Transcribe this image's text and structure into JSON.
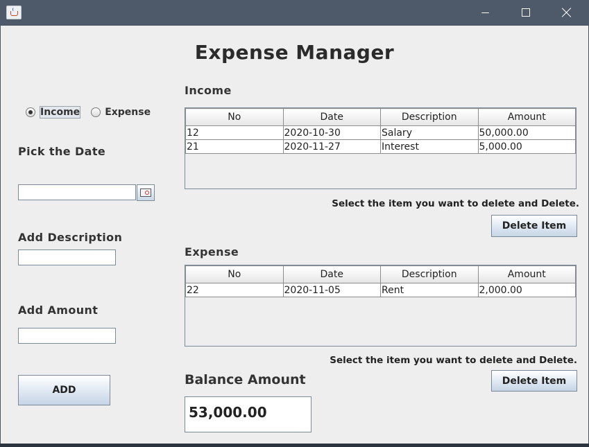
{
  "window": {
    "title": ""
  },
  "app_title": "Expense Manager",
  "entry": {
    "type_options": [
      {
        "label": "Income",
        "checked": true
      },
      {
        "label": "Expense",
        "checked": false
      }
    ],
    "date_label": "Pick the Date",
    "date_value": "",
    "description_label": "Add Description",
    "description_value": "",
    "amount_label": "Add Amount",
    "amount_value": "",
    "add_button": "ADD"
  },
  "income": {
    "title": "Income",
    "columns": [
      "No",
      "Date",
      "Description",
      "Amount"
    ],
    "rows": [
      [
        "12",
        "2020-10-30",
        "Salary",
        "50,000.00"
      ],
      [
        "21",
        "2020-11-27",
        "Interest",
        "5,000.00"
      ]
    ],
    "hint": "Select the item you want to delete and Delete.",
    "delete_button": "Delete Item"
  },
  "expense": {
    "title": "Expense",
    "columns": [
      "No",
      "Date",
      "Description",
      "Amount"
    ],
    "rows": [
      [
        "22",
        "2020-11-05",
        "Rent",
        "2,000.00"
      ]
    ],
    "hint": "Select the item you want to delete and Delete.",
    "delete_button": "Delete Item"
  },
  "balance": {
    "title": "Balance Amount",
    "value": "53,000.00"
  },
  "icons": {
    "app": "java-cup-icon",
    "minimize": "minimize-icon",
    "maximize": "maximize-icon",
    "close": "close-icon",
    "date_picker": "calendar-icon"
  },
  "colors": {
    "titlebar": "#4e5969",
    "panel": "#eeeeee",
    "button_gradient_bottom": "#c6d5e6"
  }
}
